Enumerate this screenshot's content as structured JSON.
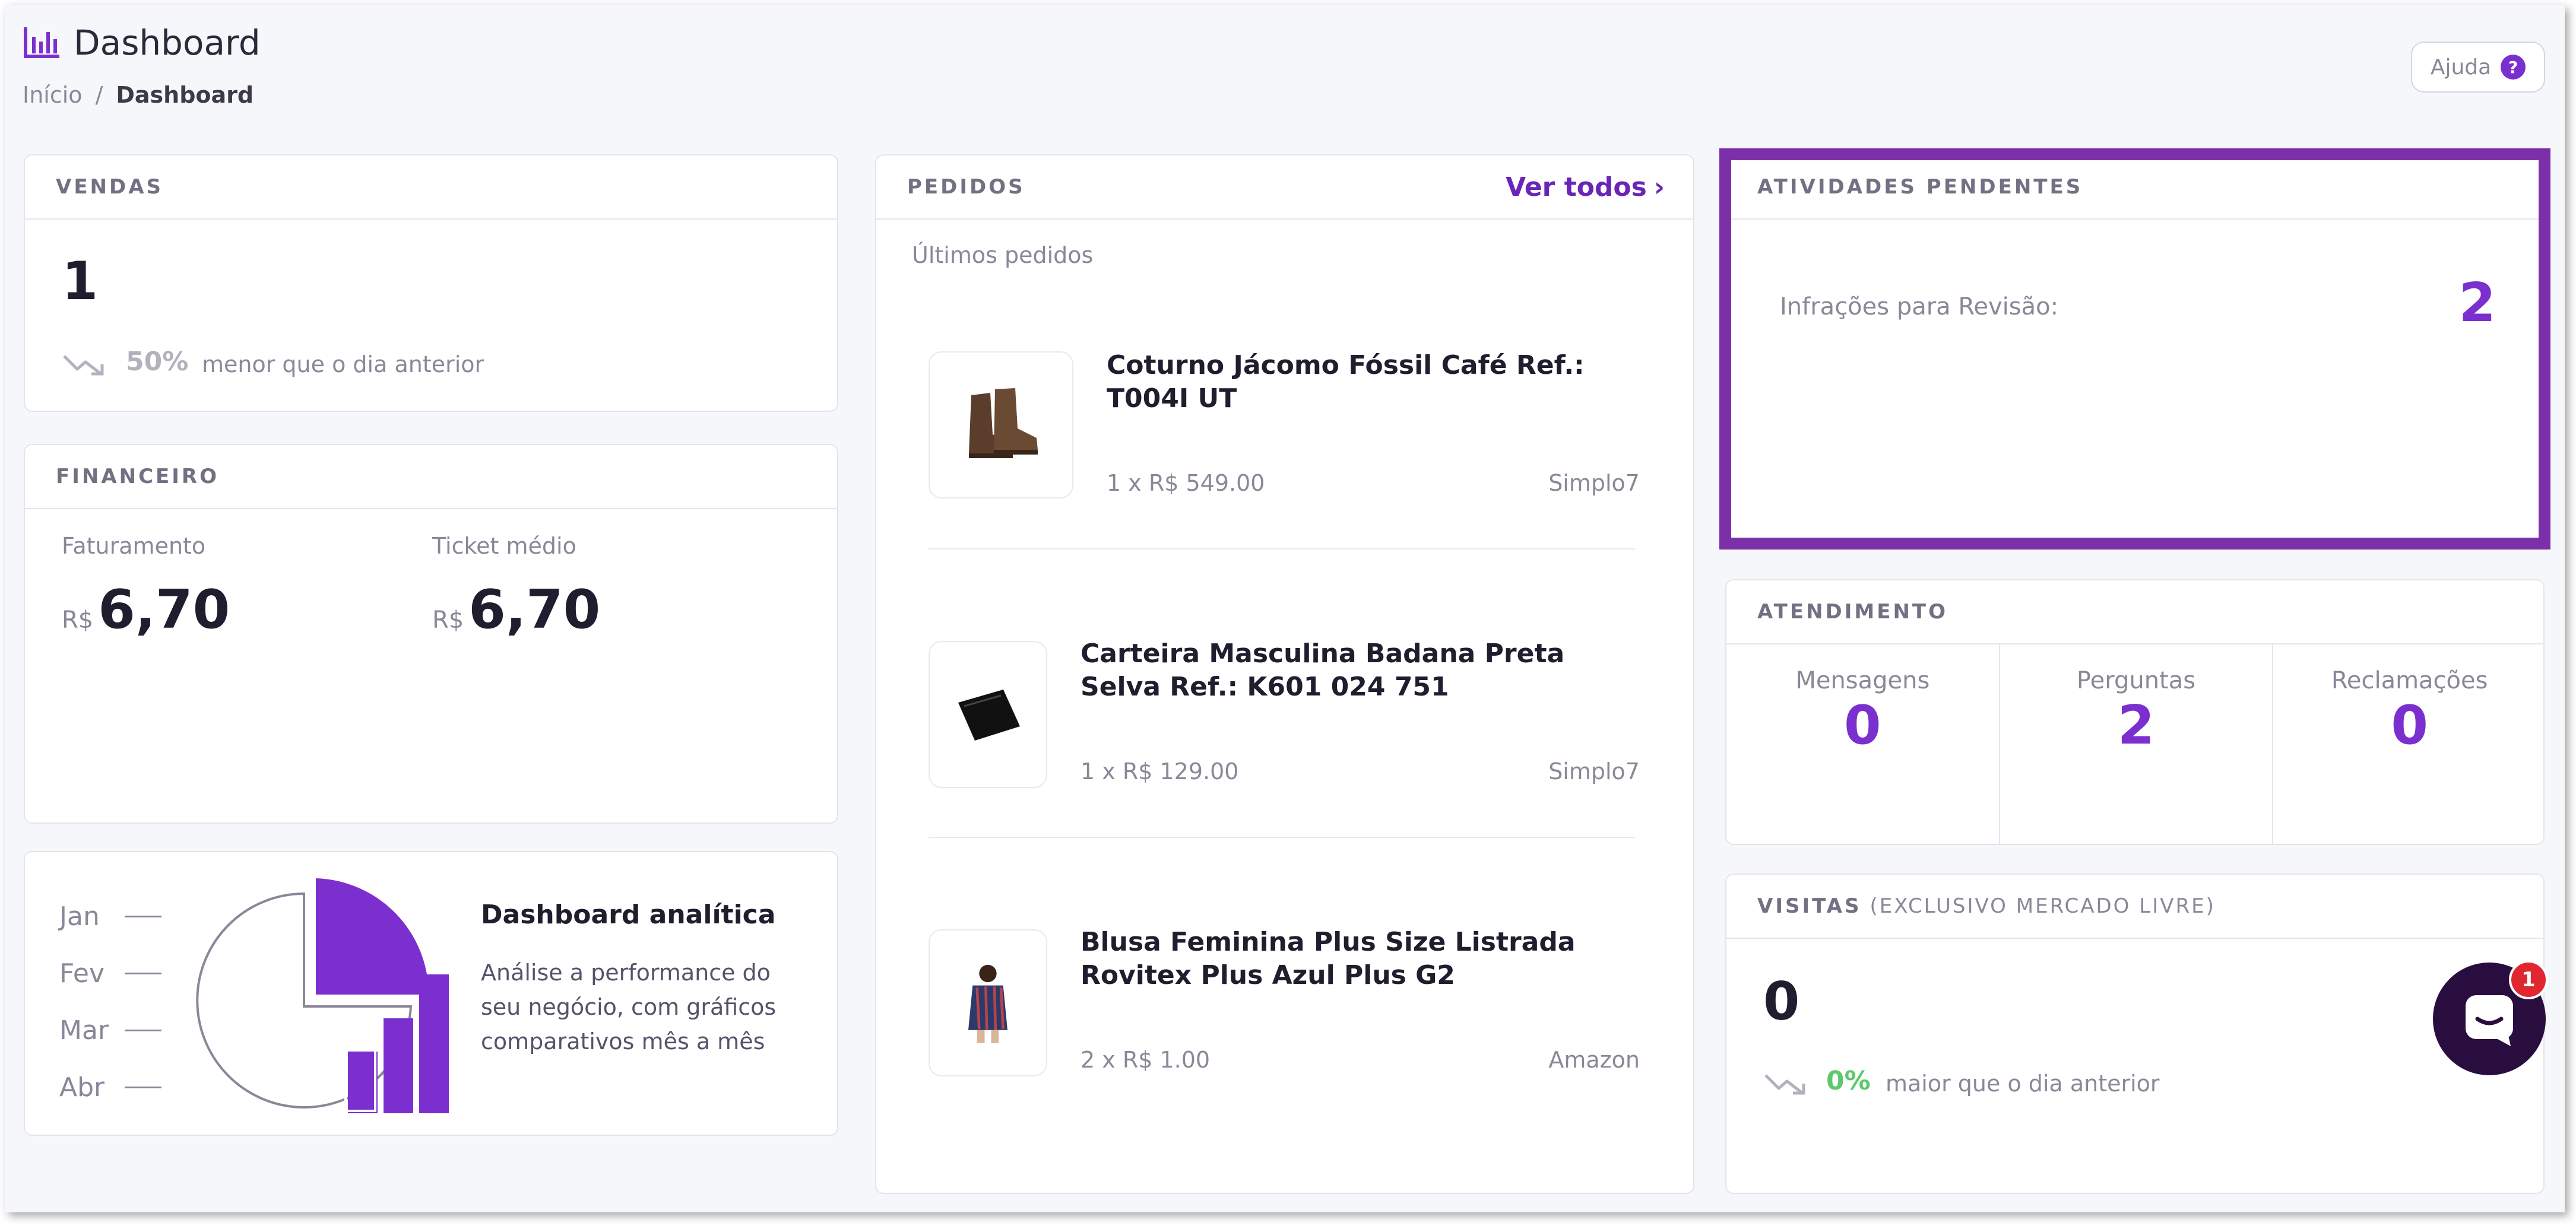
{
  "header": {
    "title": "Dashboard",
    "breadcrumb": {
      "home": "Início",
      "separator": "/",
      "current": "Dashboard"
    },
    "help_label": "Ajuda",
    "help_icon": "?"
  },
  "vendas": {
    "title": "VENDAS",
    "value": "1",
    "trend_pct": "50%",
    "trend_text": "menor que o dia anterior"
  },
  "financeiro": {
    "title": "FINANCEIRO",
    "faturamento_label": "Faturamento",
    "faturamento_currency": "R$",
    "faturamento_value": "6,70",
    "ticket_label": "Ticket médio",
    "ticket_currency": "R$",
    "ticket_value": "6,70"
  },
  "analytics": {
    "months": [
      "Jan",
      "Fev",
      "Mar",
      "Abr"
    ],
    "title": "Dashboard analítica",
    "description": "Análise a performance do seu negócio, com gráficos comparativos mês a mês"
  },
  "pedidos": {
    "title": "PEDIDOS",
    "ver_todos": "Ver todos",
    "subtitle": "Últimos pedidos",
    "orders": [
      {
        "title": "Coturno Jácomo Fóssil Café Ref.: T004I UT",
        "qty_price": "1 x R$ 549.00",
        "channel": "Simplo7",
        "thumb_icon": "boots-icon"
      },
      {
        "title": "Carteira Masculina Badana Preta Selva Ref.: K601 024 751",
        "qty_price": "1 x R$ 129.00",
        "channel": "Simplo7",
        "thumb_icon": "wallet-icon"
      },
      {
        "title": "Blusa Feminina Plus Size Listrada Rovitex Plus Azul Plus G2",
        "qty_price": "2 x R$ 1.00",
        "channel": "Amazon",
        "thumb_icon": "blouse-icon"
      }
    ]
  },
  "atividades": {
    "title": "ATIVIDADES PENDENTES",
    "label": "Infrações para Revisão:",
    "value": "2"
  },
  "atendimento": {
    "title": "ATENDIMENTO",
    "items": [
      {
        "label": "Mensagens",
        "value": "0"
      },
      {
        "label": "Perguntas",
        "value": "2"
      },
      {
        "label": "Reclamações",
        "value": "0"
      }
    ]
  },
  "visitas": {
    "title": "VISITAS",
    "title_suffix": "(EXCLUSIVO MERCADO LIVRE)",
    "value": "0",
    "trend_pct": "0%",
    "trend_text": "maior que o dia anterior"
  },
  "chat": {
    "badge": "1"
  },
  "colors": {
    "accent": "#7b2fcf",
    "highlight": "#7b2fa8",
    "positive": "#5cc96b"
  }
}
